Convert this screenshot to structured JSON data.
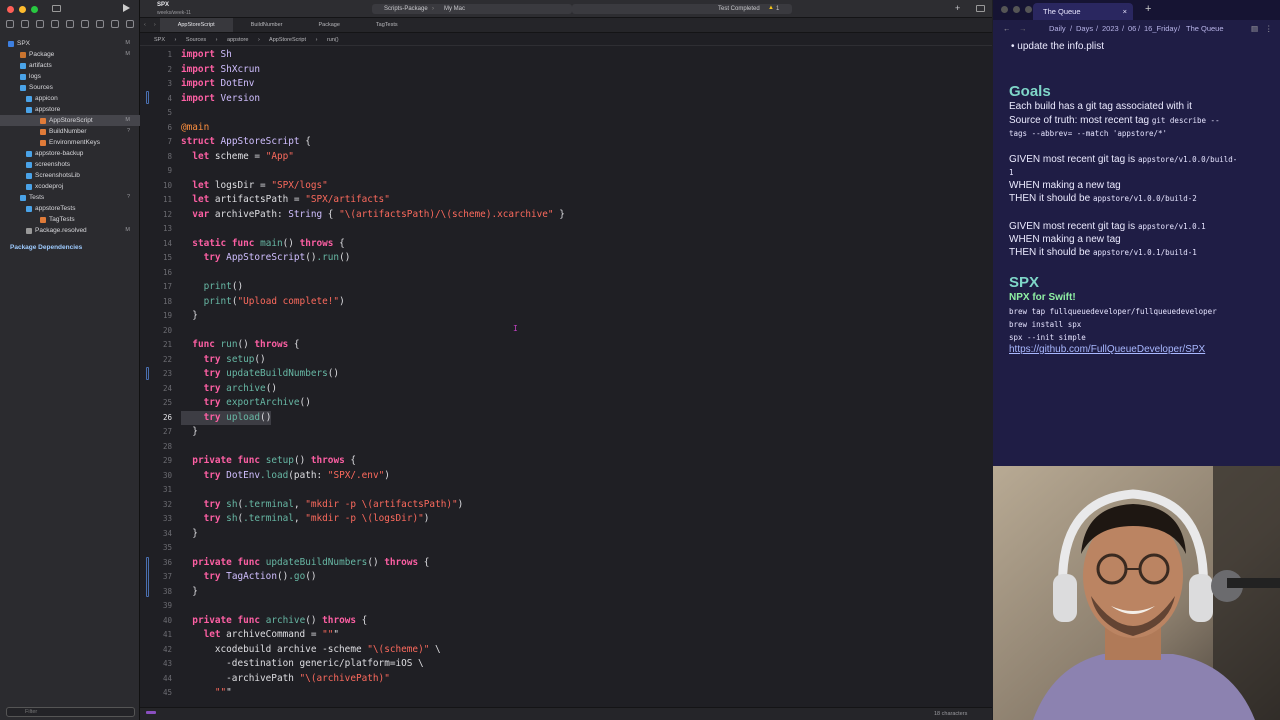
{
  "xcode": {
    "project_title": "SPX",
    "project_subtitle": "weeks/week-11",
    "scheme": "Scripts-Package",
    "destination": "My Mac",
    "status_text": "Test Completed",
    "warning_count": "1",
    "tabs": [
      "AppStoreScript",
      "BuildNumber",
      "Package",
      "TagTests"
    ],
    "jumpbar": [
      "SPX",
      "Sources",
      "appstore",
      "AppStoreScript",
      "run()"
    ],
    "statusbar_right": "18 characters",
    "filter_placeholder": "Filter",
    "navigator": [
      {
        "label": "SPX",
        "badge": "M"
      },
      {
        "label": "Package",
        "badge": "M"
      },
      {
        "label": "artifacts",
        "badge": ""
      },
      {
        "label": "logs",
        "badge": ""
      },
      {
        "label": "Sources",
        "badge": ""
      },
      {
        "label": "appicon",
        "badge": ""
      },
      {
        "label": "appstore",
        "badge": ""
      },
      {
        "label": "AppStoreScript",
        "badge": "M"
      },
      {
        "label": "BuildNumber",
        "badge": "?"
      },
      {
        "label": "EnvironmentKeys",
        "badge": ""
      },
      {
        "label": "appstore-backup",
        "badge": ""
      },
      {
        "label": "screenshots",
        "badge": ""
      },
      {
        "label": "ScreenshotsLib",
        "badge": ""
      },
      {
        "label": "xcodeproj",
        "badge": ""
      },
      {
        "label": "Tests",
        "badge": "?"
      },
      {
        "label": "appstoreTests",
        "badge": ""
      },
      {
        "label": "TagTests",
        "badge": ""
      },
      {
        "label": "Package.resolved",
        "badge": "M"
      }
    ],
    "section_label": "Package Dependencies",
    "current_line": 26,
    "code_lines": [
      "import Sh",
      "import ShXcrun",
      "import DotEnv",
      "import Version",
      "",
      "@main",
      "struct AppStoreScript {",
      "  let scheme = \"App\"",
      "",
      "  let logsDir = \"SPX/logs\"",
      "  let artifactsPath = \"SPX/artifacts\"",
      "  var archivePath: String { \"\\(artifactsPath)/\\(scheme).xcarchive\" }",
      "",
      "  static func main() throws {",
      "    try AppStoreScript().run()",
      "",
      "    print()",
      "    print(\"Upload complete!\")",
      "  }",
      "",
      "  func run() throws {",
      "    try setup()",
      "    try updateBuildNumbers()",
      "    try archive()",
      "    try exportArchive()",
      "    try upload()",
      "  }",
      "",
      "  private func setup() throws {",
      "    try DotEnv.load(path: \"SPX/.env\")",
      "",
      "    try sh(.terminal, \"mkdir -p \\(artifactsPath)\")",
      "    try sh(.terminal, \"mkdir -p \\(logsDir)\")",
      "  }",
      "",
      "  private func updateBuildNumbers() throws {",
      "    try TagAction().go()",
      "  }",
      "",
      "  private func archive() throws {",
      "    let archiveCommand = \"\"\"",
      "      xcodebuild archive -scheme \"\\(scheme)\" \\",
      "        -destination generic/platform=iOS \\",
      "        -archivePath \"\\(archivePath)\"",
      "      \"\"\""
    ]
  },
  "obsidian": {
    "tab_title": "The Queue",
    "breadcrumb": [
      "Daily",
      "Days",
      "2023",
      "06",
      "16_Friday",
      "The Queue"
    ],
    "top_bullet": "update the info.plist",
    "goals_heading": "Goals",
    "goals_lines": {
      "l1": "Each build has a git tag associated with it",
      "l2a": "Source of truth: most recent tag ",
      "l2b": "git describe --",
      "l3": "tags --abbrev= --match 'appstore/*'",
      "g1a": "GIVEN most recent git tag is ",
      "g1b": "appstore/v1.0.0/build-",
      "g1c": "1",
      "w1": "WHEN making a new tag",
      "t1a": "THEN it should be ",
      "t1b": "appstore/v1.0.0/build-2",
      "g2a": "GIVEN most recent git tag is ",
      "g2b": "appstore/v1.0.1",
      "w2": "WHEN making a new tag",
      "t2a": "THEN it should be ",
      "t2b": "appstore/v1.0.1/build-1"
    },
    "spx_heading": "SPX",
    "spx_subtitle": "NPX for Swift!",
    "spx_cmds": [
      "brew tap fullqueuedeveloper/fullqueuedeveloper",
      "brew install spx",
      "spx --init simple"
    ],
    "spx_link": "https://github.com/FullQueueDeveloper/SPX"
  },
  "colors": {
    "keyword": "#fc5fa3",
    "string": "#fc6a5d",
    "function": "#67b7a4",
    "heading": "#7fd6c8"
  }
}
